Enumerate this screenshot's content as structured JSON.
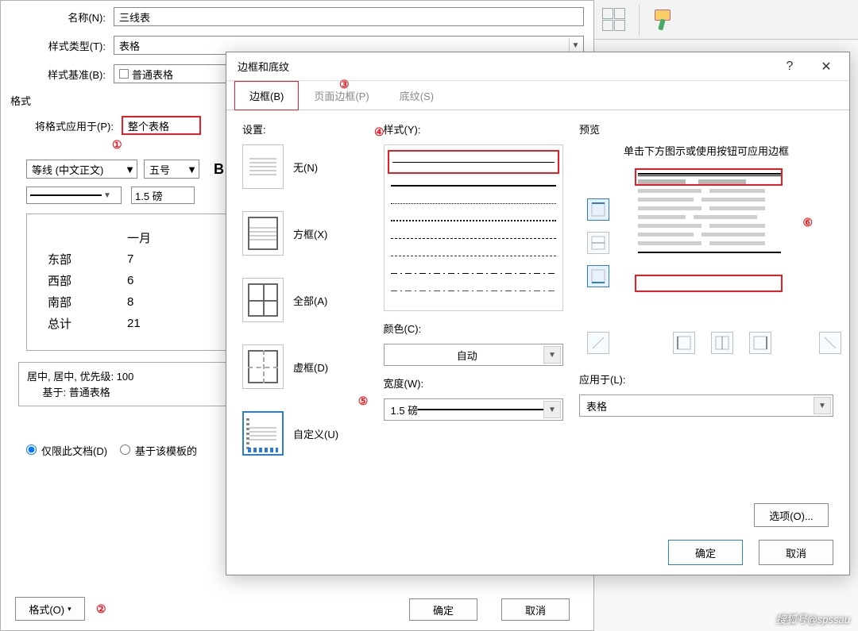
{
  "back": {
    "name_label": "名称(N):",
    "name_value": "三线表",
    "type_label": "样式类型(T):",
    "type_value": "表格",
    "base_label": "样式基准(B):",
    "base_value": "普通表格",
    "format_title": "格式",
    "apply_label": "将格式应用于(P):",
    "apply_value": "整个表格",
    "font_value": "等线 (中文正文)",
    "size_value": "五号",
    "bold": "B",
    "weight_value": "1.5 磅",
    "preview_headers": [
      "",
      "一月"
    ],
    "preview_rows": [
      [
        "东部",
        "7"
      ],
      [
        "西部",
        "6"
      ],
      [
        "南部",
        "8"
      ],
      [
        "总计",
        "21"
      ]
    ],
    "desc1": "居中, 居中, 优先级: 100",
    "desc2": "基于: 普通表格",
    "radio1": "仅限此文档(D)",
    "radio2": "基于该模板的",
    "format_btn": "格式(O)",
    "ok": "确定",
    "cancel": "取消",
    "callouts": {
      "c1": "①",
      "c2": "②"
    }
  },
  "front": {
    "title": "边框和底纹",
    "tabs": {
      "border": "边框(B)",
      "page": "页面边框(P)",
      "shading": "底纹(S)"
    },
    "setting_heading": "设置:",
    "settings": {
      "none": "无(N)",
      "box": "方框(X)",
      "all": "全部(A)",
      "dashed": "虚框(D)",
      "custom": "自定义(U)"
    },
    "style_heading": "样式(Y):",
    "color_heading": "颜色(C):",
    "color_value": "自动",
    "width_heading": "宽度(W):",
    "width_value": "1.5 磅",
    "preview_heading": "预览",
    "preview_hint": "单击下方图示或使用按钮可应用边框",
    "apply_heading": "应用于(L):",
    "apply_value": "表格",
    "options_btn": "选项(O)...",
    "ok": "确定",
    "cancel": "取消",
    "callouts": {
      "c3": "③",
      "c4": "④",
      "c5": "⑤",
      "c6": "⑥"
    }
  },
  "watermark": "搜狐号@spssau"
}
